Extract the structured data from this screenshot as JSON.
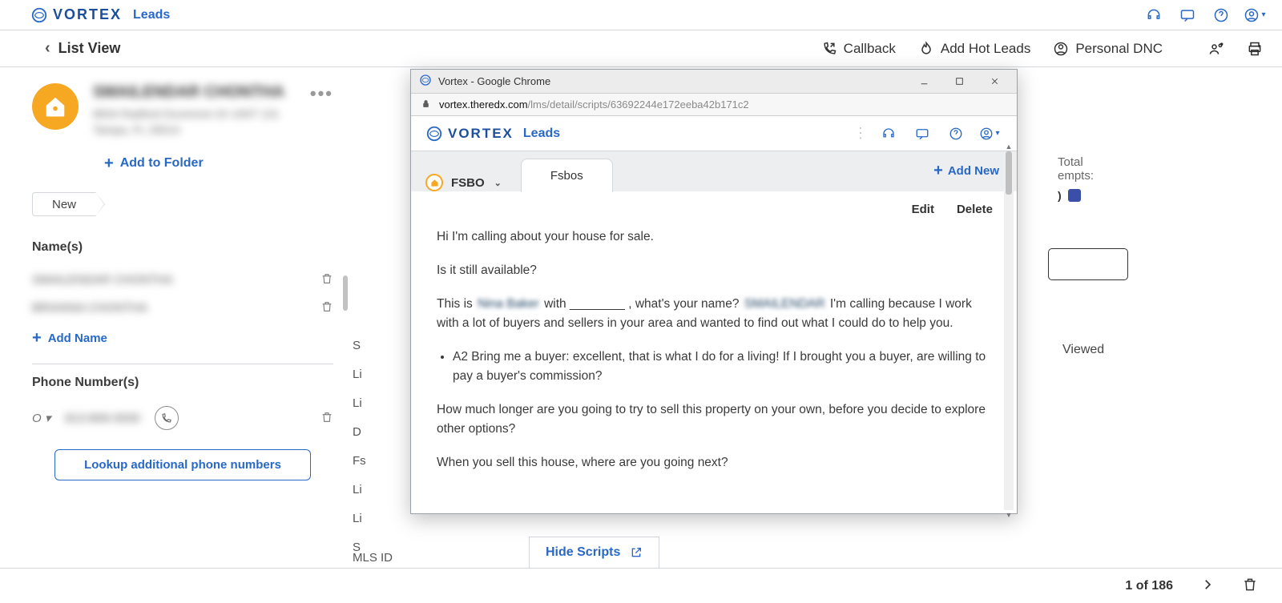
{
  "brand": {
    "name": "VORTEX",
    "sub": "Leads"
  },
  "toolbar": {
    "back": "List View",
    "callback": "Callback",
    "addHot": "Add Hot Leads",
    "dnc": "Personal DNC"
  },
  "lead": {
    "nameLine1": "SMAILENDAR",
    "nameLine2": "CHONTHA",
    "address": "8834 Radford Drummon Dr UNIT 131\nTampa, FL 29014",
    "addFolder": "Add to Folder",
    "statusChip": "New"
  },
  "sections": {
    "namesLabel": "Name(s)",
    "names": [
      "SMAILENDAR CHONTHA",
      "BRIANNA CHONTHA"
    ],
    "addName": "Add Name",
    "phonesLabel": "Phone Number(s)",
    "phoneTag": "O ▾",
    "phoneValue": "813-806-0930",
    "lookup": "Lookup additional phone numbers"
  },
  "rightPanel": {
    "totalLine1": "Total",
    "totalLine2": "empts:",
    "viewed": "Viewed",
    "hideScripts": "Hide Scripts",
    "mls": "MLS ID",
    "peek": [
      "S",
      "Li",
      "Li",
      "D",
      "Fs",
      "Li",
      "Li",
      "S"
    ]
  },
  "footer": {
    "pager": "1 of 186"
  },
  "popup": {
    "chromeTitle": "Vortex - Google Chrome",
    "urlHost": "vortex.theredx.com",
    "urlPath": "/lms/detail/scripts/63692244e172eeba42b171c2",
    "brand": {
      "name": "VORTEX",
      "sub": "Leads"
    },
    "typeLabel": "FSBO",
    "tab": "Fsbos",
    "addNew": "Add New",
    "edit": "Edit",
    "delete": "Delete",
    "script": {
      "p1": "Hi I'm calling about your house for sale.",
      "p2": "Is it still available?",
      "p3a": "This is ",
      "p3blur1": "Nina Baker",
      "p3b": " with ________ , what's your name?  ",
      "p3blur2": "SMAILENDAR",
      "p3c": "  I'm calling because I work with a lot of buyers and sellers in your area and wanted to find out what I could do to help you.",
      "li1": "A2 Bring me a buyer: excellent, that is what I do for a living!  If I brought you a buyer, are willing to pay a buyer's commission?",
      "p4": "How much longer are you going to try to sell this property on your own, before you decide to explore other options?",
      "p5": "When you sell this house, where are you going next?"
    }
  }
}
